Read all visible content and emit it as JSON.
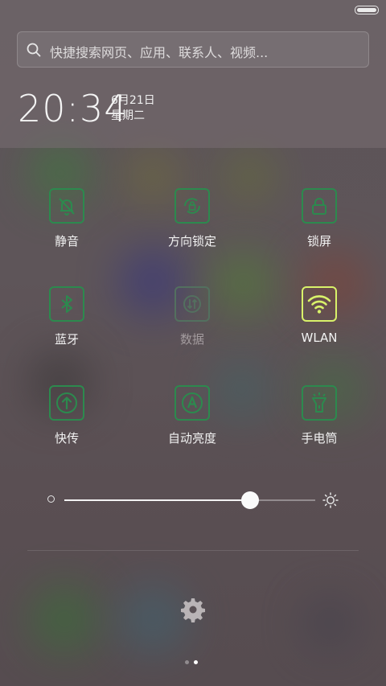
{
  "search": {
    "placeholder": "快捷搜索网页、应用、联系人、视频..."
  },
  "clock": {
    "time": "20:34",
    "date": "6月21日",
    "weekday": "星期二"
  },
  "toggles": [
    {
      "label": "静音",
      "icon": "bell-off-icon",
      "state": "on"
    },
    {
      "label": "方向锁定",
      "icon": "rotation-lock-icon",
      "state": "on"
    },
    {
      "label": "锁屏",
      "icon": "lock-icon",
      "state": "on"
    },
    {
      "label": "蓝牙",
      "icon": "bluetooth-icon",
      "state": "on"
    },
    {
      "label": "数据",
      "icon": "mobile-data-icon",
      "state": "disabled"
    },
    {
      "label": "WLAN",
      "icon": "wifi-icon",
      "state": "active"
    },
    {
      "label": "快传",
      "icon": "quick-transfer-icon",
      "state": "on"
    },
    {
      "label": "自动亮度",
      "icon": "auto-brightness-icon",
      "state": "on"
    },
    {
      "label": "手电筒",
      "icon": "flashlight-icon",
      "state": "on"
    }
  ],
  "brightness": {
    "level": 0.74
  },
  "pages": {
    "count": 2,
    "current": 2
  },
  "colors": {
    "accent_green": "#2c8a4e",
    "active_yellow": "#d9f26a",
    "panel": "#5c5458"
  }
}
